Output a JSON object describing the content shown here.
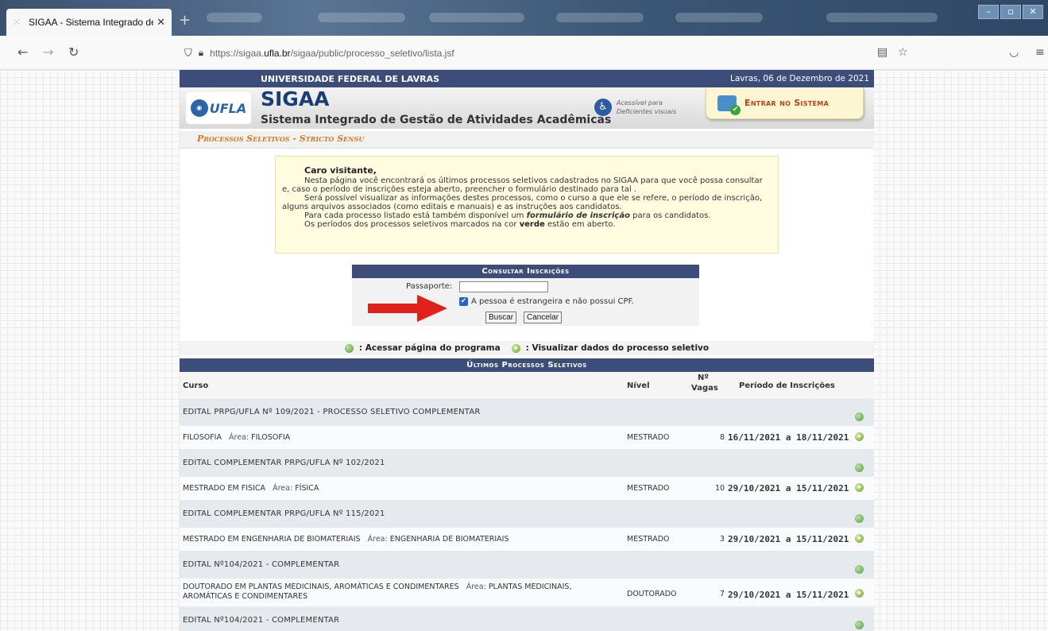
{
  "browser": {
    "tab_title": "SIGAA - Sistema Integrado de G",
    "url_prefix": "https://sigaa.",
    "url_domain": "ufla.br",
    "url_path": "/sigaa/public/processo_seletivo/lista.jsf"
  },
  "header": {
    "university": "UNIVERSIDADE FEDERAL DE LAVRAS",
    "date": "Lavras, 06 de Dezembro de 2021",
    "logo_text": "UFLA",
    "app_title": "SIGAA",
    "app_subtitle": "Sistema Integrado de Gestão de Atividades Acadêmicas",
    "access_line1": "Acessível para",
    "access_line2": "Deficientes visuais",
    "login_button": "Entrar no Sistema"
  },
  "breadcrumb": "Processos Seletivos - Stricto Sensu",
  "info": {
    "greeting": "Caro visitante,",
    "p1": "Nesta página você encontrará os últimos processos seletivos cadastrados no SIGAA para que você possa consultar e, caso o período de inscrições esteja aberto, preencher o formulário destinado para tal .",
    "p2": "Será possível visualizar as informações destes processos, como o curso a que ele se refere, o período de inscrição, alguns arquivos associados (como editais e manuais) e as instruções aos candidatos.",
    "p3a": "Para cada processo listado está também disponível um ",
    "p3b": "formulário de inscrição",
    "p3c": " para os candidatos.",
    "p4a": "Os períodos dos processos seletivos marcados na cor ",
    "p4b": "verde",
    "p4c": " estão em aberto."
  },
  "form": {
    "title": "Consultar Inscrições",
    "passport_label": "Passaporte:",
    "passport_value": "",
    "checkbox_label": "A pessoa é estrangeira e não possui CPF.",
    "checkbox_checked": true,
    "search_button": "Buscar",
    "cancel_button": "Cancelar"
  },
  "legend": {
    "program": ": Acessar página do programa",
    "view": ": Visualizar dados do processo seletivo"
  },
  "table": {
    "title": "Últimos Processos Seletivos",
    "headers": {
      "curso": "Curso",
      "nivel": "Nível",
      "vagas_top": "Nº",
      "vagas_bottom": "Vagas",
      "periodo": "Período de Inscrições"
    },
    "editais": [
      {
        "title": "EDITAL PRPG/UFLA Nº 109/2021 - PROCESSO SELETIVO COMPLEMENTAR",
        "curso": "FILOSOFIA",
        "area": "FILOSOFIA",
        "nivel": "MESTRADO",
        "vagas": "8",
        "periodo": "16/11/2021 a 18/11/2021"
      },
      {
        "title": "EDITAL COMPLEMENTAR PRPG/UFLA Nº 102/2021",
        "curso": "MESTRADO EM FISICA",
        "area": "FÍSICA",
        "nivel": "MESTRADO",
        "vagas": "10",
        "periodo": "29/10/2021 a 15/11/2021"
      },
      {
        "title": "EDITAL COMPLEMENTAR PRPG/UFLA Nº 115/2021",
        "curso": "MESTRADO EM ENGENHARIA DE BIOMATERIAIS",
        "area": "ENGENHARIA DE BIOMATERIAIS",
        "nivel": "MESTRADO",
        "vagas": "3",
        "periodo": "29/10/2021 a 15/11/2021"
      },
      {
        "title": "EDITAL Nº104/2021 - COMPLEMENTAR",
        "curso": "DOUTORADO EM PLANTAS MEDICINAIS, AROMÁTICAS E CONDIMENTARES",
        "area": "PLANTAS MEDICINAIS, AROMÁTICAS E CONDIMENTARES",
        "nivel": "DOUTORADO",
        "vagas": "7",
        "periodo": "29/10/2021 a 15/11/2021"
      },
      {
        "title": "EDITAL Nº104/2021 - COMPLEMENTAR"
      }
    ],
    "area_label": "Área:",
    "range_sep": " a "
  },
  "colors": {
    "header_blue": "#3c4d7a",
    "accent_orange": "#d67a1f",
    "login_text": "#c04010",
    "info_bg": "#fffce0",
    "arrow_red": "#e0201a"
  }
}
